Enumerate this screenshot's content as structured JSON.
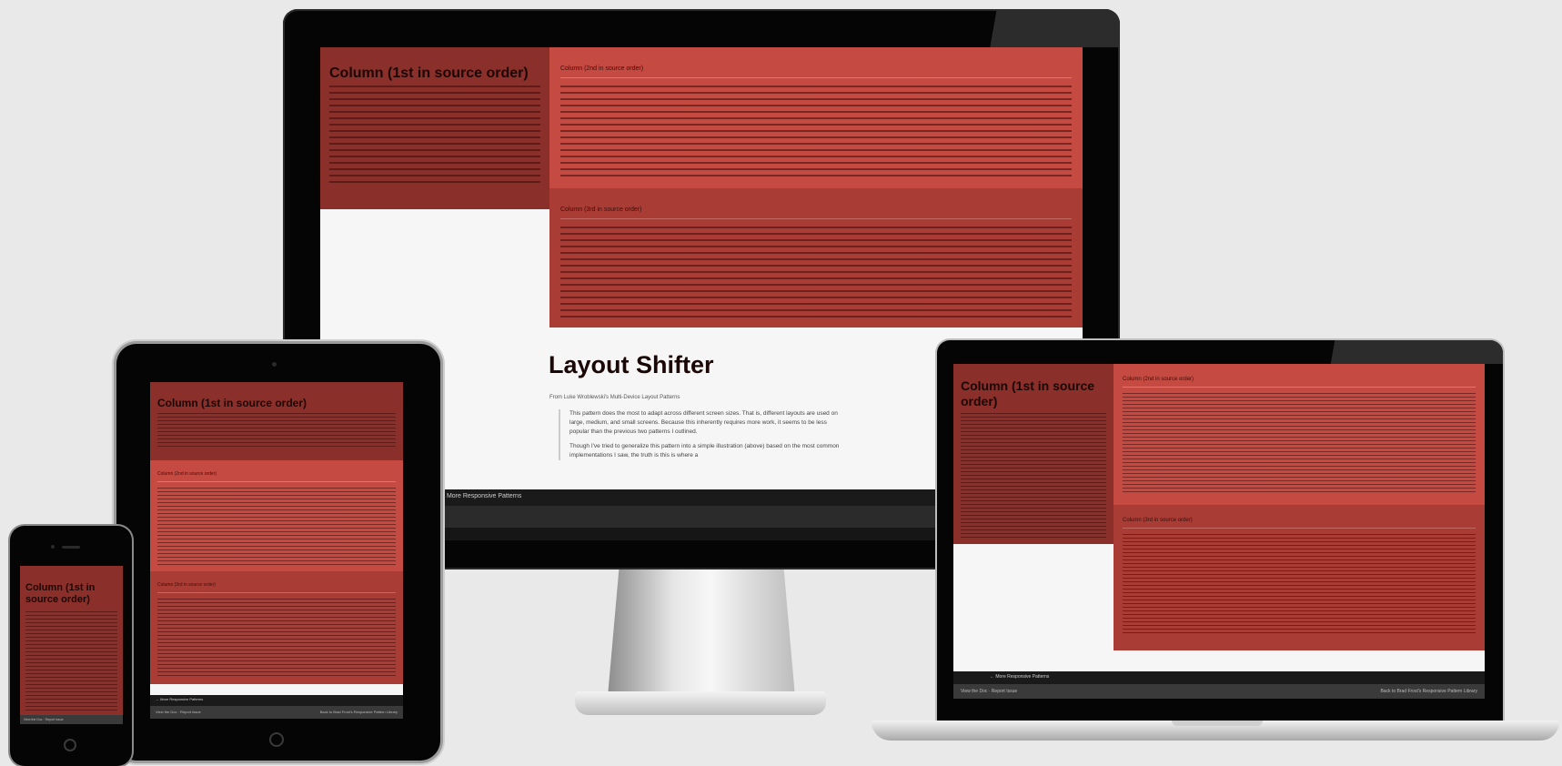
{
  "col1_title": "Column (1st in source order)",
  "col1_title_short_phone": "Column (1st in source order)",
  "col2_title": "Column (2nd in source order)",
  "col3_title": "Column (3rd in source order)",
  "page_heading": "Layout Shifter",
  "page_subtitle": "From Luke Wroblewski's Multi-Device Layout Patterns",
  "intro_p1": "This pattern does the most to adapt across different screen sizes. That is, different layouts are used on large, medium, and small screens. Because this inherently requires more work, it seems to be less popular than the previous two patterns I outlined.",
  "intro_p2": "Though I've tried to generalize this pattern into a simple illustration (above) based on the most common implementations I saw, the truth is this is where a",
  "nav_label": "← More Responsive Patterns",
  "footer_left": "View the Doc · Report Issue",
  "footer_right": "Back to Brad Frost's Responsive Pattern Library",
  "colors": {
    "background": "#e9e9e9",
    "column_1": "#8a2f29",
    "column_2": "#c44a42",
    "column_3": "#a93c35",
    "device_frame": "#0b0b0b"
  }
}
